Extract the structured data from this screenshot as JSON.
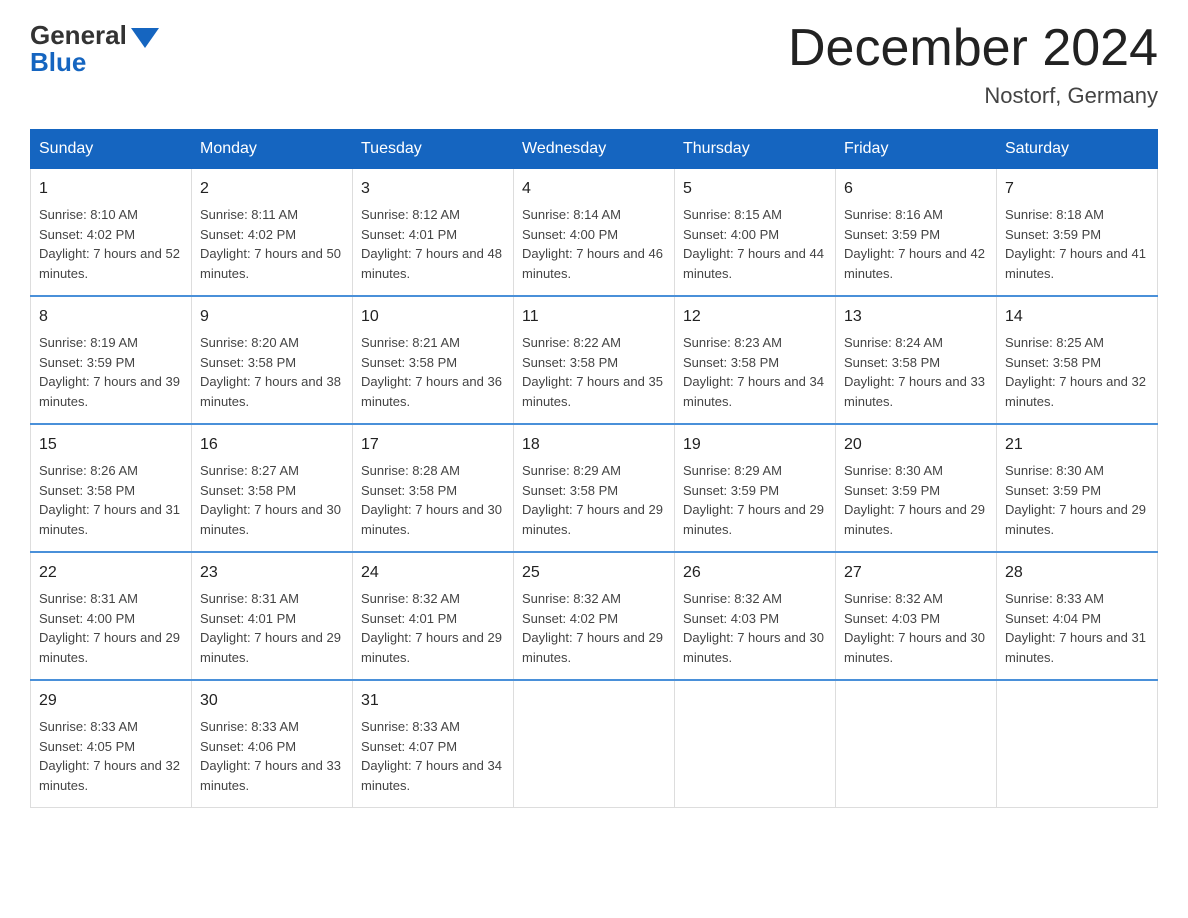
{
  "header": {
    "logo_general": "General",
    "logo_blue": "Blue",
    "main_title": "December 2024",
    "subtitle": "Nostorf, Germany"
  },
  "weekdays": [
    "Sunday",
    "Monday",
    "Tuesday",
    "Wednesday",
    "Thursday",
    "Friday",
    "Saturday"
  ],
  "weeks": [
    [
      {
        "day": "1",
        "sunrise": "8:10 AM",
        "sunset": "4:02 PM",
        "daylight": "7 hours and 52 minutes."
      },
      {
        "day": "2",
        "sunrise": "8:11 AM",
        "sunset": "4:02 PM",
        "daylight": "7 hours and 50 minutes."
      },
      {
        "day": "3",
        "sunrise": "8:12 AM",
        "sunset": "4:01 PM",
        "daylight": "7 hours and 48 minutes."
      },
      {
        "day": "4",
        "sunrise": "8:14 AM",
        "sunset": "4:00 PM",
        "daylight": "7 hours and 46 minutes."
      },
      {
        "day": "5",
        "sunrise": "8:15 AM",
        "sunset": "4:00 PM",
        "daylight": "7 hours and 44 minutes."
      },
      {
        "day": "6",
        "sunrise": "8:16 AM",
        "sunset": "3:59 PM",
        "daylight": "7 hours and 42 minutes."
      },
      {
        "day": "7",
        "sunrise": "8:18 AM",
        "sunset": "3:59 PM",
        "daylight": "7 hours and 41 minutes."
      }
    ],
    [
      {
        "day": "8",
        "sunrise": "8:19 AM",
        "sunset": "3:59 PM",
        "daylight": "7 hours and 39 minutes."
      },
      {
        "day": "9",
        "sunrise": "8:20 AM",
        "sunset": "3:58 PM",
        "daylight": "7 hours and 38 minutes."
      },
      {
        "day": "10",
        "sunrise": "8:21 AM",
        "sunset": "3:58 PM",
        "daylight": "7 hours and 36 minutes."
      },
      {
        "day": "11",
        "sunrise": "8:22 AM",
        "sunset": "3:58 PM",
        "daylight": "7 hours and 35 minutes."
      },
      {
        "day": "12",
        "sunrise": "8:23 AM",
        "sunset": "3:58 PM",
        "daylight": "7 hours and 34 minutes."
      },
      {
        "day": "13",
        "sunrise": "8:24 AM",
        "sunset": "3:58 PM",
        "daylight": "7 hours and 33 minutes."
      },
      {
        "day": "14",
        "sunrise": "8:25 AM",
        "sunset": "3:58 PM",
        "daylight": "7 hours and 32 minutes."
      }
    ],
    [
      {
        "day": "15",
        "sunrise": "8:26 AM",
        "sunset": "3:58 PM",
        "daylight": "7 hours and 31 minutes."
      },
      {
        "day": "16",
        "sunrise": "8:27 AM",
        "sunset": "3:58 PM",
        "daylight": "7 hours and 30 minutes."
      },
      {
        "day": "17",
        "sunrise": "8:28 AM",
        "sunset": "3:58 PM",
        "daylight": "7 hours and 30 minutes."
      },
      {
        "day": "18",
        "sunrise": "8:29 AM",
        "sunset": "3:58 PM",
        "daylight": "7 hours and 29 minutes."
      },
      {
        "day": "19",
        "sunrise": "8:29 AM",
        "sunset": "3:59 PM",
        "daylight": "7 hours and 29 minutes."
      },
      {
        "day": "20",
        "sunrise": "8:30 AM",
        "sunset": "3:59 PM",
        "daylight": "7 hours and 29 minutes."
      },
      {
        "day": "21",
        "sunrise": "8:30 AM",
        "sunset": "3:59 PM",
        "daylight": "7 hours and 29 minutes."
      }
    ],
    [
      {
        "day": "22",
        "sunrise": "8:31 AM",
        "sunset": "4:00 PM",
        "daylight": "7 hours and 29 minutes."
      },
      {
        "day": "23",
        "sunrise": "8:31 AM",
        "sunset": "4:01 PM",
        "daylight": "7 hours and 29 minutes."
      },
      {
        "day": "24",
        "sunrise": "8:32 AM",
        "sunset": "4:01 PM",
        "daylight": "7 hours and 29 minutes."
      },
      {
        "day": "25",
        "sunrise": "8:32 AM",
        "sunset": "4:02 PM",
        "daylight": "7 hours and 29 minutes."
      },
      {
        "day": "26",
        "sunrise": "8:32 AM",
        "sunset": "4:03 PM",
        "daylight": "7 hours and 30 minutes."
      },
      {
        "day": "27",
        "sunrise": "8:32 AM",
        "sunset": "4:03 PM",
        "daylight": "7 hours and 30 minutes."
      },
      {
        "day": "28",
        "sunrise": "8:33 AM",
        "sunset": "4:04 PM",
        "daylight": "7 hours and 31 minutes."
      }
    ],
    [
      {
        "day": "29",
        "sunrise": "8:33 AM",
        "sunset": "4:05 PM",
        "daylight": "7 hours and 32 minutes."
      },
      {
        "day": "30",
        "sunrise": "8:33 AM",
        "sunset": "4:06 PM",
        "daylight": "7 hours and 33 minutes."
      },
      {
        "day": "31",
        "sunrise": "8:33 AM",
        "sunset": "4:07 PM",
        "daylight": "7 hours and 34 minutes."
      },
      null,
      null,
      null,
      null
    ]
  ],
  "labels": {
    "sunrise_prefix": "Sunrise: ",
    "sunset_prefix": "Sunset: ",
    "daylight_prefix": "Daylight: "
  }
}
